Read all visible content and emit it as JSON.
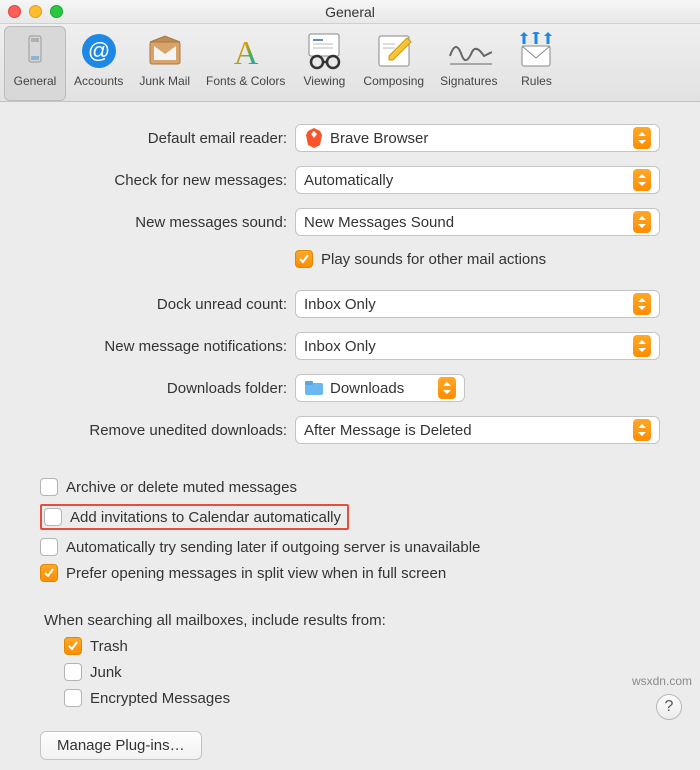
{
  "window": {
    "title": "General"
  },
  "toolbar": {
    "items": [
      {
        "label": "General",
        "selected": true
      },
      {
        "label": "Accounts"
      },
      {
        "label": "Junk Mail"
      },
      {
        "label": "Fonts & Colors"
      },
      {
        "label": "Viewing"
      },
      {
        "label": "Composing"
      },
      {
        "label": "Signatures"
      },
      {
        "label": "Rules"
      }
    ]
  },
  "settings": {
    "default_reader": {
      "label": "Default email reader:",
      "value": "Brave Browser"
    },
    "check_messages": {
      "label": "Check for new messages:",
      "value": "Automatically"
    },
    "sound": {
      "label": "New messages sound:",
      "value": "New Messages Sound"
    },
    "play_sounds": {
      "label": "Play sounds for other mail actions",
      "checked": true
    },
    "dock_unread": {
      "label": "Dock unread count:",
      "value": "Inbox Only"
    },
    "notifications": {
      "label": "New message notifications:",
      "value": "Inbox Only"
    },
    "downloads": {
      "label": "Downloads folder:",
      "value": "Downloads"
    },
    "remove_downloads": {
      "label": "Remove unedited downloads:",
      "value": "After Message is Deleted"
    }
  },
  "checks": {
    "archive_muted": {
      "label": "Archive or delete muted messages",
      "checked": false
    },
    "add_invites": {
      "label": "Add invitations to Calendar automatically",
      "checked": false,
      "highlighted": true
    },
    "try_later": {
      "label": "Automatically try sending later if outgoing server is unavailable",
      "checked": false
    },
    "split_view": {
      "label": "Prefer opening messages in split view when in full screen",
      "checked": true
    }
  },
  "search": {
    "heading": "When searching all mailboxes, include results from:",
    "trash": {
      "label": "Trash",
      "checked": true
    },
    "junk": {
      "label": "Junk",
      "checked": false
    },
    "encrypted": {
      "label": "Encrypted Messages",
      "checked": false
    }
  },
  "plugins_button": "Manage Plug-ins…",
  "watermark": "wsxdn.com"
}
